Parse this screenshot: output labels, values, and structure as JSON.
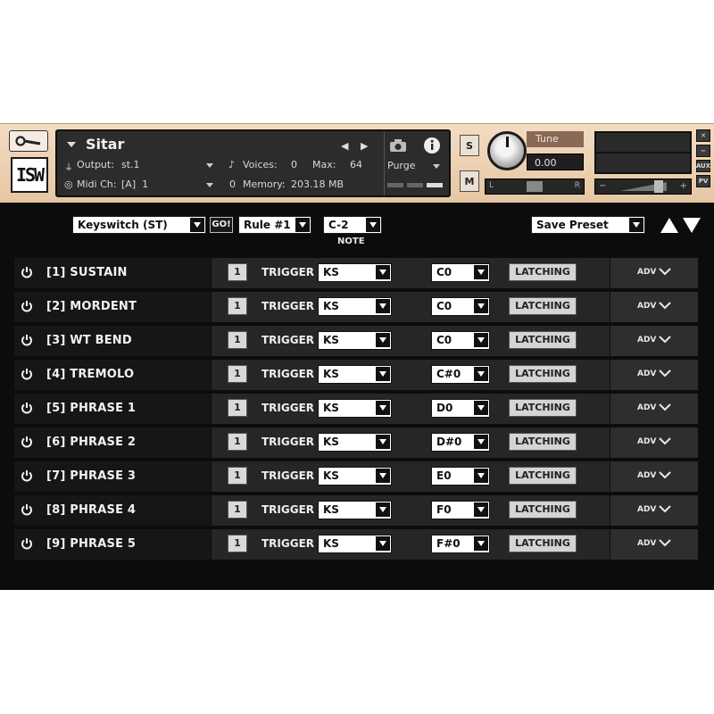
{
  "header": {
    "instrument_name": "Sitar",
    "output_label": "Output:",
    "output_value": "st.1",
    "midi_label": "Midi Ch:",
    "midi_value": "[A]  1",
    "voices_label": "Voices:",
    "voices_value": "0",
    "max_label": "Max:",
    "max_value": "64",
    "memory_prefix": "0",
    "memory_label": "Memory:",
    "memory_value": "203.18 MB",
    "purge_label": "Purge",
    "solo_label": "S",
    "mute_label": "M",
    "tune_label": "Tune",
    "tune_value": "0.00",
    "pan_left": "L",
    "pan_right": "R",
    "vol_minus": "−",
    "vol_plus": "+",
    "side_aux": "AUX",
    "side_pv": "PV",
    "logo": "ISW"
  },
  "toolbar": {
    "mode_select": "Keyswitch (ST)",
    "go_label": "GO!",
    "rule_select": "Rule #1",
    "note_select": "C-2",
    "note_caption": "NOTE",
    "preset_select": "Save Preset"
  },
  "articulations": [
    {
      "label": "[1]  SUSTAIN",
      "num": "1",
      "trigger": "TRIGGER",
      "type": "KS",
      "note": "C0",
      "mode": "LATCHING",
      "adv": "ADV"
    },
    {
      "label": "[2]  MORDENT",
      "num": "1",
      "trigger": "TRIGGER",
      "type": "KS",
      "note": "C0",
      "mode": "LATCHING",
      "adv": "ADV"
    },
    {
      "label": "[3]  WT BEND",
      "num": "1",
      "trigger": "TRIGGER",
      "type": "KS",
      "note": "C0",
      "mode": "LATCHING",
      "adv": "ADV"
    },
    {
      "label": "[4]  TREMOLO",
      "num": "1",
      "trigger": "TRIGGER",
      "type": "KS",
      "note": "C#0",
      "mode": "LATCHING",
      "adv": "ADV"
    },
    {
      "label": "[5]  PHRASE 1",
      "num": "1",
      "trigger": "TRIGGER",
      "type": "KS",
      "note": "D0",
      "mode": "LATCHING",
      "adv": "ADV"
    },
    {
      "label": "[6]  PHRASE 2",
      "num": "1",
      "trigger": "TRIGGER",
      "type": "KS",
      "note": "D#0",
      "mode": "LATCHING",
      "adv": "ADV"
    },
    {
      "label": "[7]  PHRASE 3",
      "num": "1",
      "trigger": "TRIGGER",
      "type": "KS",
      "note": "E0",
      "mode": "LATCHING",
      "adv": "ADV"
    },
    {
      "label": "[8]  PHRASE 4",
      "num": "1",
      "trigger": "TRIGGER",
      "type": "KS",
      "note": "F0",
      "mode": "LATCHING",
      "adv": "ADV"
    },
    {
      "label": "[9]  PHRASE 5",
      "num": "1",
      "trigger": "TRIGGER",
      "type": "KS",
      "note": "F#0",
      "mode": "LATCHING",
      "adv": "ADV"
    }
  ]
}
